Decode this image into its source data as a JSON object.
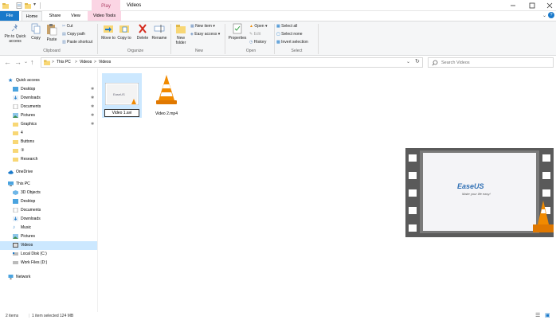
{
  "titlebar": {
    "context_tab": "Play",
    "title": "Videos",
    "buttons": {
      "minimize": "—",
      "maximize": "☐",
      "close": "✕"
    }
  },
  "tabs": {
    "file": "File",
    "home": "Home",
    "share": "Share",
    "view": "View",
    "video_tools": "Video Tools",
    "help": "?"
  },
  "ribbon": {
    "clipboard": {
      "pin_to_quick_access": "Pin to Quick access",
      "copy": "Copy",
      "paste": "Paste",
      "cut": "Cut",
      "copy_path": "Copy path",
      "paste_shortcut": "Paste shortcut",
      "label": "Clipboard"
    },
    "organize": {
      "move_to": "Move to",
      "copy_to": "Copy to",
      "delete": "Delete",
      "rename": "Rename",
      "label": "Organize"
    },
    "new": {
      "new_folder": "New folder",
      "new_item": "New item",
      "easy_access": "Easy access",
      "label": "New"
    },
    "open": {
      "properties": "Properties",
      "open": "Open",
      "edit": "Edit",
      "history": "History",
      "label": "Open"
    },
    "select": {
      "select_all": "Select all",
      "select_none": "Select none",
      "invert_selection": "Invert selection",
      "label": "Select"
    }
  },
  "address": {
    "crumbs": [
      "This PC",
      "Videos",
      "Videos"
    ],
    "separator": ">",
    "search_placeholder": "Search Videos"
  },
  "nav": {
    "quick_access": "Quick access",
    "quick_items": [
      "Desktop",
      "Downloads",
      "Documents",
      "Pictures",
      "Graphics",
      "4",
      "Buttons",
      "③",
      "Research"
    ],
    "onedrive": "OneDrive",
    "this_pc": "This PC",
    "pc_items": [
      "3D Objects",
      "Desktop",
      "Documents",
      "Downloads",
      "Music",
      "Pictures",
      "Videos",
      "Local Disk (C:)",
      "Work Files (D:)"
    ],
    "network": "Network"
  },
  "files": [
    {
      "name": "Video 1.avi",
      "selected": true,
      "type": "video-thumbnail"
    },
    {
      "name": "Video 2.mp4",
      "selected": false,
      "type": "vlc-cone"
    }
  ],
  "preview": {
    "brand": "EaseUS",
    "tagline": "Make your life easy!"
  },
  "status": {
    "items": "2 items",
    "selection": "1 item selected  124 MB"
  },
  "colors": {
    "accent": "#1979ca",
    "selection": "#cce8ff",
    "vlc_orange": "#f18a00",
    "play_context": "#fbd5e4",
    "folder_yellow": "#f8d775"
  }
}
